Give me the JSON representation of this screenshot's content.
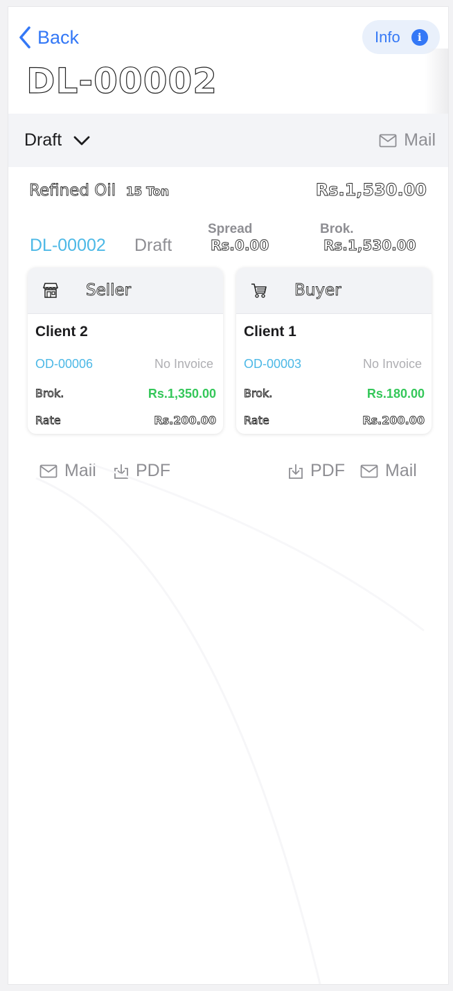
{
  "nav": {
    "back_label": "Back",
    "info_label": "Info",
    "title": "DL-00002"
  },
  "status_bar": {
    "status": "Draft",
    "mail_label": "Mail"
  },
  "summary": {
    "product": "Refined Oil",
    "quantity": "15 Ton",
    "total": "Rs.1,530.00",
    "deal_id": "DL-00002",
    "deal_status": "Draft",
    "spread_label": "Spread",
    "spread_value": "Rs.0.00",
    "brok_label": "Brok.",
    "brok_value": "Rs.1,530.00"
  },
  "seller": {
    "role": "Seller",
    "client": "Client 2",
    "order_id": "OD-00006",
    "invoice": "No Invoice",
    "brok_label": "Brok.",
    "brok_value": "Rs.1,350.00",
    "rate_label": "Rate",
    "rate_value": "Rs.200.00",
    "mail_label": "Mail",
    "pdf_label": "PDF"
  },
  "buyer": {
    "role": "Buyer",
    "client": "Client 1",
    "order_id": "OD-00003",
    "invoice": "No Invoice",
    "brok_label": "Brok.",
    "brok_value": "Rs.180.00",
    "rate_label": "Rate",
    "rate_value": "Rs.200.00",
    "mail_label": "Mail",
    "pdf_label": "PDF"
  },
  "colors": {
    "accent": "#3478f6",
    "link": "#4cb8e6",
    "positive": "#34c759",
    "muted": "#8e8e93"
  },
  "icons": {
    "back": "chevron-left-icon",
    "info": "info-circle-icon",
    "status_toggle": "chevron-down-icon",
    "mail": "envelope-icon",
    "pdf": "download-icon",
    "seller": "store-icon",
    "buyer": "cart-icon"
  }
}
